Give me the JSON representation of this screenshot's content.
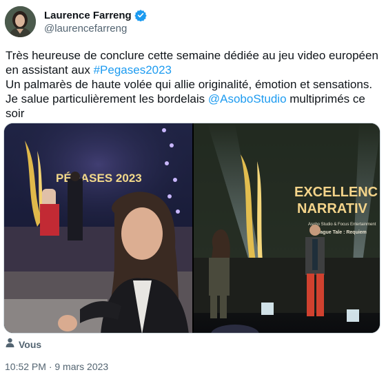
{
  "author": {
    "name": "Laurence Farreng",
    "handle": "@laurencefarreng"
  },
  "tweet": {
    "lines": [
      [
        {
          "t": "Très heureuse de conclure cette semaine dédiée au jeu video européen"
        }
      ],
      [
        {
          "t": "en assistant aux "
        },
        {
          "t": "#Pegases2023",
          "link": true
        }
      ],
      [
        {
          "t": "Un palmarès de haute volée qui allie originalité, émotion et sensations."
        }
      ],
      [
        {
          "t": "Je salue particulièrement les bordelais "
        },
        {
          "t": "@AsoboStudio",
          "link": true
        },
        {
          "t": " multiprimés ce"
        }
      ],
      [
        {
          "t": "soir"
        }
      ]
    ]
  },
  "media": {
    "left_photo": {
      "stage_title": "PÉGASES 2023"
    },
    "right_photo": {
      "screen_line1": "EXCELLENC",
      "screen_line2": "NARRATIV",
      "screen_sub1": "Asobo Studio & Focus Entertainment",
      "screen_sub2": "A Plague Tale : Requiem"
    }
  },
  "tagged": {
    "label": "Vous",
    "icon": "person-icon"
  },
  "timestamp": "10:52 PM · 9 mars 2023",
  "colors": {
    "link": "#1d9bf0",
    "secondary": "#536471",
    "verified": "#1d9bf0"
  }
}
